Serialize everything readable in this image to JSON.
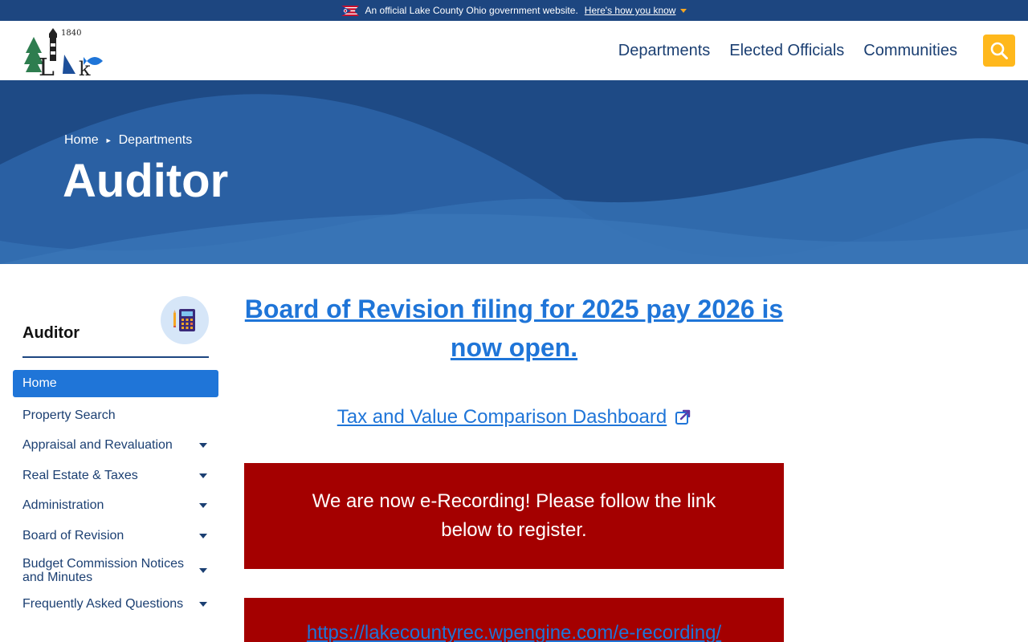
{
  "banner": {
    "text": "An official Lake County Ohio government website.",
    "link": "Here's how you know"
  },
  "logo": {
    "year": "1840",
    "word": "Lake"
  },
  "nav": {
    "items": [
      "Departments",
      "Elected Officials",
      "Communities"
    ]
  },
  "colors": {
    "accent": "#1f75d8",
    "navy": "#1d4680",
    "search": "#ffb81c",
    "alert": "#a40000"
  },
  "hero": {
    "breadcrumb": [
      "Home",
      "Departments"
    ],
    "title": "Auditor"
  },
  "sidebar": {
    "title": "Auditor",
    "icon": "calculator-icon",
    "items": [
      {
        "label": "Home",
        "active": true
      },
      {
        "label": "Property Search"
      },
      {
        "label": "Appraisal and Revaluation",
        "expandable": true
      },
      {
        "label": "Real Estate & Taxes",
        "expandable": true
      },
      {
        "label": "Administration",
        "expandable": true
      },
      {
        "label": "Board of Revision",
        "expandable": true
      },
      {
        "label": "Budget Commission Notices and Minutes",
        "expandable": true
      },
      {
        "label": "Frequently Asked Questions",
        "expandable": true
      }
    ]
  },
  "main": {
    "headline": "Board of Revision filing for 2025 pay 2026 is now open.",
    "dashboard_link": "Tax and Value Comparison Dashboard",
    "notice": "We are now e-Recording! Please follow the link below to register.",
    "erecord_link": "https://lakecountyrec.wpengine.com/e-recording/"
  }
}
